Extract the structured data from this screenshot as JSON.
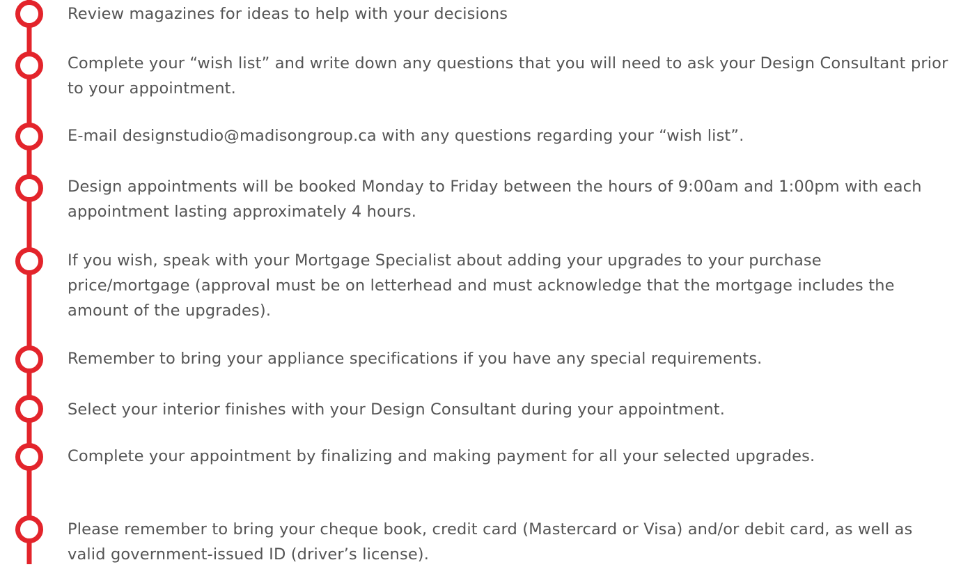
{
  "theme": {
    "accent_color": "#e3242b",
    "text_color": "#545454"
  },
  "steps": [
    {
      "text": "Review magazines for ideas to help with your decisions"
    },
    {
      "text": "Complete your “wish list” and write down any questions that you will need to ask your Design Consultant prior to your appointment."
    },
    {
      "text": "E-mail designstudio@madisongroup.ca with any questions regarding your “wish list”."
    },
    {
      "text": "Design appointments will be booked Monday to Friday between the hours of 9:00am and 1:00pm with each appointment lasting approximately 4 hours."
    },
    {
      "text": "If you wish, speak with your Mortgage Specialist about adding your upgrades to your purchase price/mortgage (approval must be on letterhead and must acknowledge that the mortgage includes the amount of the upgrades)."
    },
    {
      "text": "Remember to bring your appliance specifications if you have any special requirements."
    },
    {
      "text": "Select your interior finishes with your Design Consultant during your appointment."
    },
    {
      "text": "Complete your appointment by finalizing and making payment for all your selected upgrades."
    },
    {
      "text": "Please remember to bring your cheque book, credit card (Mastercard or Visa) and/or debit card, as well as valid government-issued ID (driver’s license)."
    }
  ]
}
